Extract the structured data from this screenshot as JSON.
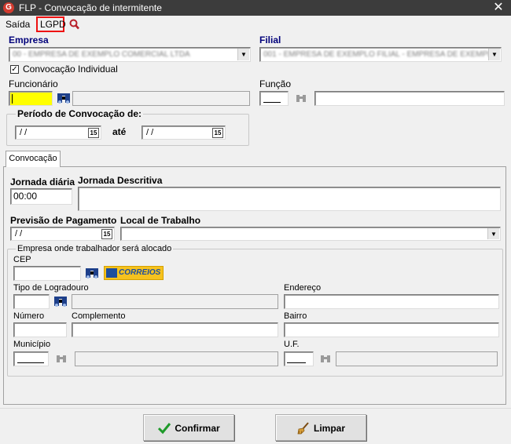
{
  "window": {
    "title": "FLP - Convocação de intermitente",
    "logo": "G",
    "close": "✕"
  },
  "menu": {
    "items": [
      "Saída",
      "LGPD"
    ]
  },
  "empresa": {
    "label": "Empresa",
    "value": "00 - EMPRESA DE EXEMPLO COMERCIAL LTDA"
  },
  "filial": {
    "label": "Filial",
    "value": "001 - EMPRESA DE EXEMPLO FILIAL - EMPRESA DE EXEMPLO"
  },
  "convocacao_individual": {
    "label": "Convocação Individual",
    "checked": true,
    "mark": "✓"
  },
  "funcionario": {
    "label": "Funcionário",
    "value": ""
  },
  "funcao": {
    "label": "Função",
    "value": ""
  },
  "periodo": {
    "title": "Período de Convocação de:",
    "from": " / /",
    "to_label": "até",
    "to": " / /"
  },
  "tabs": [
    {
      "label": "Convocação"
    }
  ],
  "jornada": {
    "diaria_label": "Jornada diária",
    "diaria_value": "00:00",
    "descritiva_label": "Jornada Descritiva"
  },
  "previsao": {
    "label": "Previsão de Pagamento",
    "value": " / /"
  },
  "local": {
    "label": "Local de Trabalho"
  },
  "alocacao": {
    "title": "Empresa onde trabalhador será alocado",
    "cep_label": "CEP",
    "correios_label": "CORREIOS",
    "tipo_logradouro_label": "Tipo de Logradouro",
    "endereco_label": "Endereço",
    "numero_label": "Número",
    "complemento_label": "Complemento",
    "bairro_label": "Bairro",
    "municipio_label": "Município",
    "uf_label": "U.F."
  },
  "calendar_glyph": "15",
  "buttons": {
    "confirmar": "Confirmar",
    "limpar": "Limpar"
  }
}
